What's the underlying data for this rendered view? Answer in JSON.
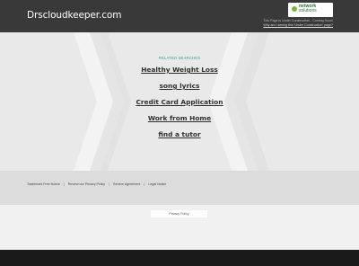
{
  "header": {
    "site_title": "Drscloudkeeper.com",
    "logo": {
      "line1": "network",
      "line2": "solutions"
    },
    "construction_text": "This Page is Under Construction - Coming Soon!",
    "construction_link": "Why am I seeing this 'Under Construction' page?"
  },
  "main": {
    "related_label": "RELATED SEARCHES",
    "searches": [
      "Healthy Weight Loss",
      "song lyrics",
      "Credit Card Application",
      "Work from Home",
      "find a tutor"
    ]
  },
  "footer": {
    "links": [
      "Trademark Free Notice",
      "Review our Privacy Policy",
      "Service Agreement",
      "Legal Notice"
    ],
    "privacy_button": "Privacy Policy"
  },
  "colors": {
    "header_bg": "#393939",
    "accent_teal": "#2aa39a",
    "logo_green": "#2f6e3b"
  }
}
